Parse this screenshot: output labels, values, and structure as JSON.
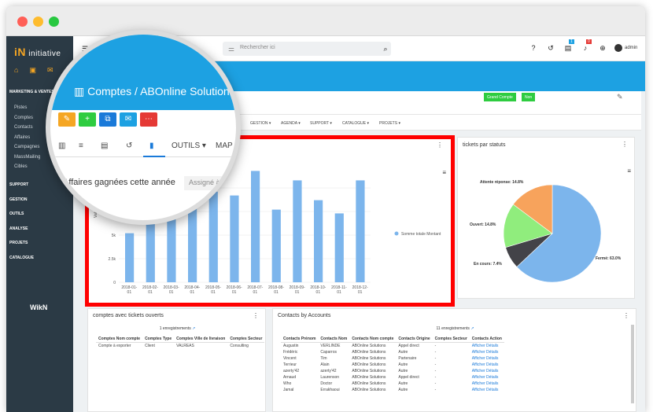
{
  "app": {
    "name": "initiative",
    "footer_logo": "WikN"
  },
  "search": {
    "placeholder": "Rechercher ici"
  },
  "user": {
    "label": "admin"
  },
  "badges": {
    "tasks": "1",
    "notifications": "0"
  },
  "sidebar": {
    "section_marketing": "MARKETING & VENTES",
    "items": [
      "Pistes",
      "Comptes",
      "Contacts",
      "Affaires",
      "Campagnes",
      "MassMailing",
      "Cibles"
    ],
    "sections": [
      "SUPPORT",
      "GESTION",
      "OUTILS",
      "ANALYSE",
      "PROJETS",
      "CATALOGUE"
    ]
  },
  "header": {
    "breadcrumb_module": "Comptes",
    "breadcrumb_sep": "/",
    "breadcrumb_record": "ABOnline Solutions",
    "grand_compte_label": "Grand Compte",
    "grand_compte_value": "Non"
  },
  "menu": {
    "items": [
      "GESTION ▾",
      "AGENDA ▾",
      "SUPPORT ▾",
      "CATALOGUE ▾",
      "PROJETS ▾"
    ]
  },
  "magnifier": {
    "tab_outils": "OUTILS ▾",
    "tab_map": "MAP",
    "chart_title": "Affaires gagnées cette année",
    "assign_placeholder": "Assigné à"
  },
  "chart_data": [
    {
      "type": "bar",
      "title": "Affaires gagnées cette année",
      "categories": [
        "2018-01-01",
        "2018-02-01",
        "2018-03-01",
        "2018-04-01",
        "2018-05-01",
        "2018-06-01",
        "2018-07-01",
        "2018-08-01",
        "2018-09-01",
        "2018-10-01",
        "2018-11-01",
        "2018-12-01"
      ],
      "series": [
        {
          "name": "Somme totale Montant",
          "values": [
            5200,
            7200,
            7500,
            8000,
            9600,
            9200,
            11800,
            7700,
            10800,
            8700,
            7300,
            10800
          ],
          "color": "#7cb5ec"
        }
      ],
      "ylabel": "Values",
      "yticks": [
        "0",
        "2.5k",
        "5k",
        "7.5k",
        "10k"
      ],
      "ylim": [
        0,
        12500
      ],
      "legend": "right"
    },
    {
      "type": "pie",
      "title": "tickets par statuts",
      "labels": [
        "Fermé",
        "En cours",
        "Ouvert",
        "Attente réponse"
      ],
      "display_labels": [
        "Fermé: 63.0%",
        "En cours: 7.4%",
        "Ouvert: 14.8%",
        "Attente réponse: 14.8%"
      ],
      "values": [
        63.0,
        7.4,
        14.8,
        14.8
      ],
      "colors": [
        "#7cb5ec",
        "#434348",
        "#90ed7d",
        "#f7a35c"
      ]
    }
  ],
  "comptes_panel": {
    "title": "comptes avec tickets ouverts",
    "count": "1 enregistrements",
    "headers": [
      "Comptes Nom compte",
      "Comptes Type",
      "Comptes Ville de livraison",
      "Comptes Secteur"
    ],
    "rows": [
      [
        "Compte à exporter",
        "Client",
        "VALREAS",
        "Consulting"
      ]
    ]
  },
  "contacts_panel": {
    "title": "Contacts by Accounts",
    "count": "11 enregistrements",
    "headers": [
      "Contacts Prénom",
      "Contacts Nom",
      "Contacts Nom compte",
      "Contacts Origine",
      "Comptes Secteur",
      "Contacts Action"
    ],
    "rows": [
      [
        "Augustin",
        "VERLINDE",
        "ABOnline Solutions",
        "Appel direct",
        "-",
        "Afficher Détails"
      ],
      [
        "Frédéric",
        "Caparros",
        "ABOnline Solutions",
        "Autre",
        "-",
        "Afficher Détails"
      ],
      [
        "Vincent",
        "Tim",
        "ABOnline Solutions",
        "Partenaire",
        "-",
        "Afficher Détails"
      ],
      [
        "Terrieur",
        "Alain",
        "ABOnline Solutions",
        "Autre",
        "-",
        "Afficher Détails"
      ],
      [
        "azerty'42",
        "azerty'42",
        "ABOnline Solutions",
        "Autre",
        "-",
        "Afficher Détails"
      ],
      [
        "Arnaud",
        "Laurenson",
        "ABOnline Solutions",
        "Appel direct",
        "-",
        "Afficher Détails"
      ],
      [
        "Who",
        "Doctor",
        "ABOnline Solutions",
        "Autre",
        "-",
        "Afficher Détails"
      ],
      [
        "Jamal",
        "Errakhaoui",
        "ABOnline Solutions",
        "Autre",
        "-",
        "Afficher Détails"
      ]
    ]
  }
}
